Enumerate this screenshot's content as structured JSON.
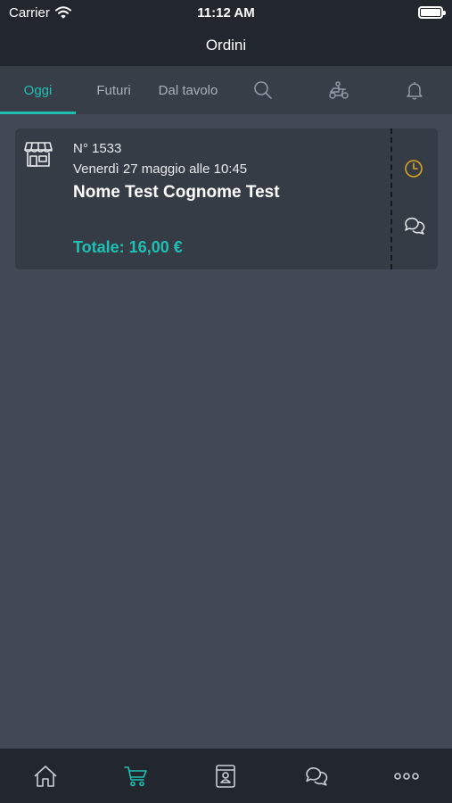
{
  "status_bar": {
    "carrier": "Carrier",
    "time": "11:12 AM"
  },
  "nav": {
    "title": "Ordini"
  },
  "tabs": [
    {
      "label": "Oggi",
      "active": true
    },
    {
      "label": "Futuri",
      "active": false
    },
    {
      "label": "Dal tavolo",
      "active": false
    }
  ],
  "tab_icons": [
    "search-icon",
    "scooter-icon",
    "bell-icon"
  ],
  "order": {
    "number": "N° 1533",
    "date": "Venerdì 27 maggio alle 10:45",
    "customer": "Nome Test Cognome Test",
    "total": "Totale: 16,00 €",
    "type_icon": "shop-icon",
    "status_icon": "clock-icon",
    "message_icon": "chat-icon"
  },
  "bottom_nav": [
    "home-icon",
    "cart-icon",
    "contacts-icon",
    "chat-icon",
    "more-icon"
  ],
  "colors": {
    "accent": "#1fc0b4",
    "status_warning": "#d9a521",
    "background": "#414955",
    "card": "#363c46",
    "bar": "#22272e"
  }
}
